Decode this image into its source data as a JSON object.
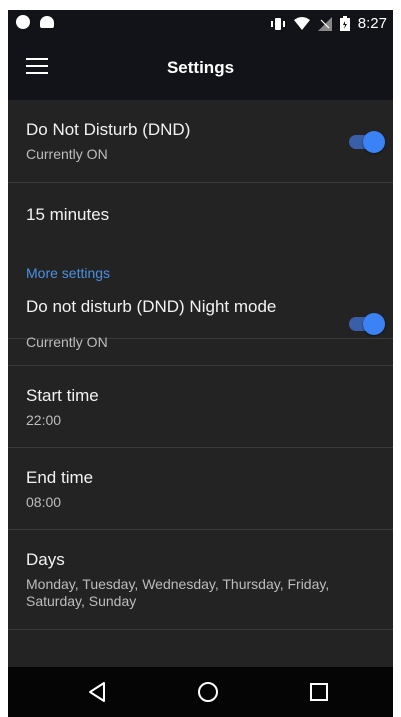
{
  "status_bar": {
    "time": "8:27"
  },
  "app_bar": {
    "title": "Settings",
    "menu_icon": "hamburger-menu-icon"
  },
  "settings": {
    "dnd": {
      "label": "Do Not Disturb (DND)",
      "status": "Currently ON",
      "enabled": true
    },
    "duration": {
      "label": "15 minutes"
    },
    "more_header": "More settings",
    "night_mode": {
      "label": "Do not disturb (DND) Night mode",
      "status": "Currently ON",
      "enabled": true
    },
    "start_time": {
      "label": "Start time",
      "value": "22:00"
    },
    "end_time": {
      "label": "End time",
      "value": "08:00"
    },
    "days": {
      "label": "Days",
      "value": "Monday, Tuesday, Wednesday, Thursday, Friday, Saturday, Sunday"
    }
  },
  "colors": {
    "background": "#232323",
    "app_bar": "#111318",
    "accent": "#4a90e2",
    "toggle_on": "#3b82f6"
  }
}
